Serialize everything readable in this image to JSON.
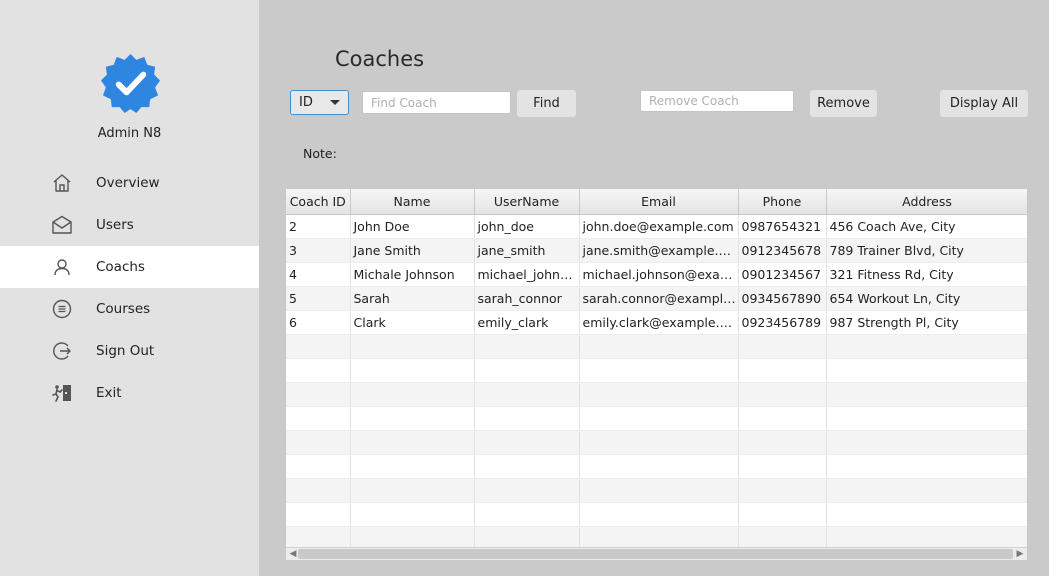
{
  "sidebar": {
    "admin_name": "Admin N8",
    "items": [
      {
        "label": "Overview",
        "icon": "home-icon"
      },
      {
        "label": "Users",
        "icon": "envelope-icon"
      },
      {
        "label": "Coachs",
        "icon": "user-icon",
        "active": true
      },
      {
        "label": "Courses",
        "icon": "list-circle-icon"
      },
      {
        "label": "Sign Out",
        "icon": "sign-out-icon"
      },
      {
        "label": "Exit",
        "icon": "exit-icon"
      }
    ]
  },
  "main": {
    "title": "Coaches",
    "filter_select": {
      "value": "ID"
    },
    "find_input": {
      "placeholder": "Find Coach",
      "value": ""
    },
    "find_button": "Find",
    "remove_input": {
      "placeholder": "Remove Coach",
      "value": ""
    },
    "remove_button": "Remove",
    "display_all_button": "Display All",
    "note_label": "Note:"
  },
  "table": {
    "columns": [
      "Coach ID",
      "Name",
      "UserName",
      "Email",
      "Phone",
      "Address"
    ],
    "rows": [
      [
        "2",
        "John Doe",
        "john_doe",
        "john.doe@example.com",
        "0987654321",
        "456 Coach Ave, City"
      ],
      [
        "3",
        "Jane Smith",
        "jane_smith",
        "jane.smith@example.com",
        "0912345678",
        "789 Trainer Blvd, City"
      ],
      [
        "4",
        "Michale Johnson",
        "michael_johnson",
        "michael.johnson@exam...",
        "0901234567",
        "321 Fitness Rd, City"
      ],
      [
        "5",
        "Sarah",
        "sarah_connor",
        "sarah.connor@example....",
        "0934567890",
        "654 Workout Ln, City"
      ],
      [
        "6",
        "Clark",
        "emily_clark",
        "emily.clark@example.com",
        "0923456789",
        "987 Strength Pl, City"
      ]
    ]
  },
  "colors": {
    "sidebar_bg": "#e2e2e2",
    "main_bg": "#cacaca",
    "accent": "#3d8fd6",
    "badge": "#2f86e0"
  }
}
